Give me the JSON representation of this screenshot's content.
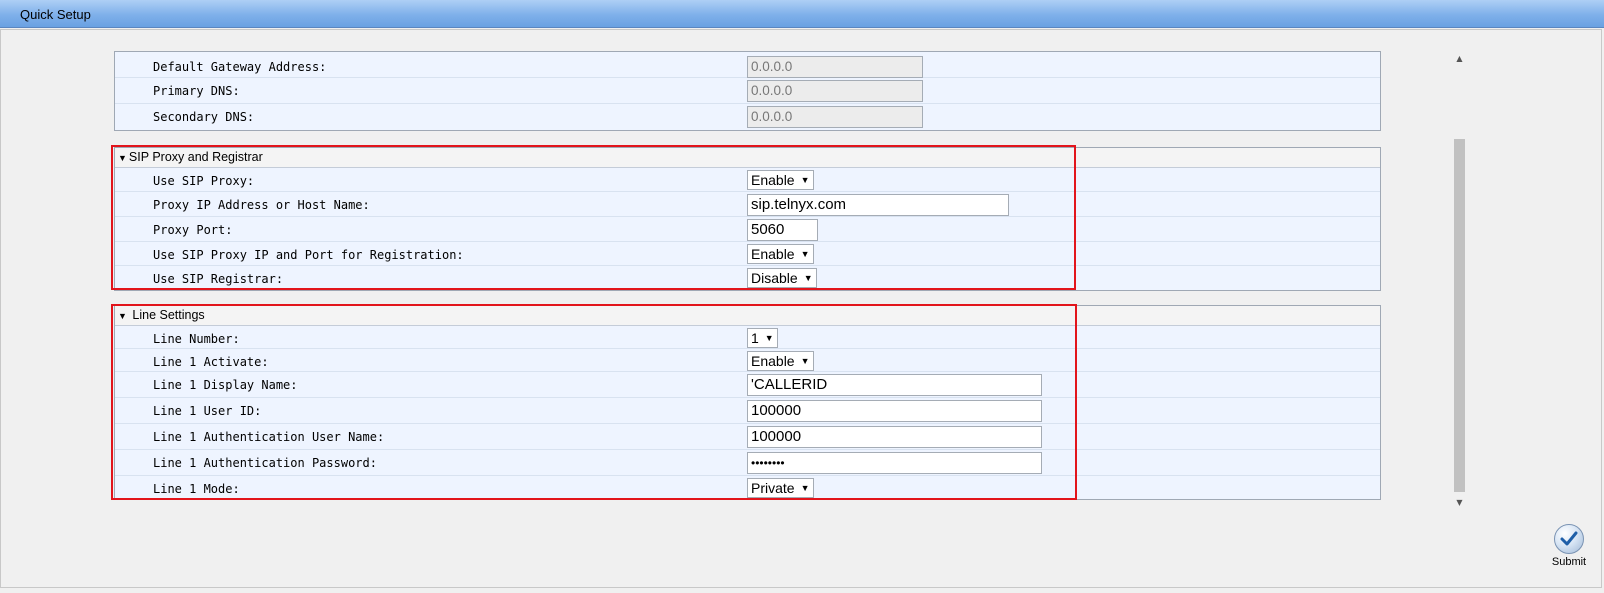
{
  "window": {
    "title": "Quick Setup"
  },
  "network": {
    "rows": [
      {
        "label": "Default Gateway Address:",
        "value": "0.0.0.0"
      },
      {
        "label": "Primary DNS:",
        "value": "0.0.0.0"
      },
      {
        "label": "Secondary DNS:",
        "value": "0.0.0.0"
      }
    ]
  },
  "sip": {
    "title": "SIP Proxy and Registrar",
    "use_proxy": {
      "label": "Use SIP Proxy:",
      "value": "Enable"
    },
    "proxy_host": {
      "label": "Proxy IP Address or Host Name:",
      "value": "sip.telnyx.com"
    },
    "proxy_port": {
      "label": "Proxy Port:",
      "value": "5060"
    },
    "proxy_reg": {
      "label": "Use SIP Proxy IP and Port for Registration:",
      "value": "Enable"
    },
    "use_registrar": {
      "label": "Use SIP Registrar:",
      "value": "Disable"
    }
  },
  "line": {
    "title": "Line Settings",
    "number": {
      "label": "Line Number:",
      "value": "1"
    },
    "activate": {
      "label": "Line 1 Activate:",
      "value": "Enable"
    },
    "display_name": {
      "label": "Line 1 Display Name:",
      "value": "'CALLERID"
    },
    "user_id": {
      "label": "Line 1 User ID:",
      "value": "100000"
    },
    "auth_user": {
      "label": "Line 1 Authentication User Name:",
      "value": "100000"
    },
    "auth_password": {
      "label": "Line 1 Authentication Password:",
      "value": "••••••••"
    },
    "mode": {
      "label": "Line 1 Mode:",
      "value": "Private"
    }
  },
  "submit": {
    "label": "Submit"
  },
  "colors": {
    "highlight": "#e2141b",
    "title_bar": "#7fb0ea",
    "row_bg": "#eef4ff"
  }
}
